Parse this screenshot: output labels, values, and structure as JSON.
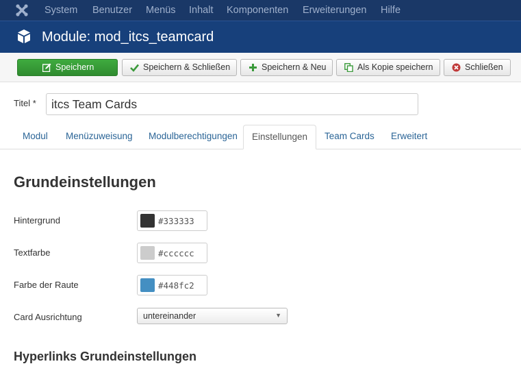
{
  "topnav": {
    "logo_icon": "joomla-logo-icon",
    "items": [
      "System",
      "Benutzer",
      "Menüs",
      "Inhalt",
      "Komponenten",
      "Erweiterungen",
      "Hilfe"
    ]
  },
  "titlebar": {
    "icon": "cube-icon",
    "title": "Module: mod_itcs_teamcard"
  },
  "toolbar": {
    "save": "Speichern",
    "save_close": "Speichern & Schließen",
    "save_new": "Speichern & Neu",
    "save_copy": "Als Kopie speichern",
    "close": "Schließen"
  },
  "form": {
    "title_label": "Titel *",
    "title_value": "itcs Team Cards"
  },
  "tabs": [
    "Modul",
    "Menüzuweisung",
    "Modulberechtigungen",
    "Einstellungen",
    "Team Cards",
    "Erweitert"
  ],
  "active_tab": "Einstellungen",
  "settings": {
    "heading": "Grundeinstellungen",
    "background_label": "Hintergrund",
    "background_value": "#333333",
    "textcolor_label": "Textfarbe",
    "textcolor_value": "#cccccc",
    "diamond_label": "Farbe der Raute",
    "diamond_value": "#448fc2",
    "orientation_label": "Card Ausrichtung",
    "orientation_value": "untereinander",
    "hyperlinks_heading": "Hyperlinks Grundeinstellungen"
  },
  "colors": {
    "nav_bg": "#1a3867",
    "title_bg": "#17407b",
    "save_green": "#2f8b2f",
    "link_blue": "#2a6496"
  }
}
